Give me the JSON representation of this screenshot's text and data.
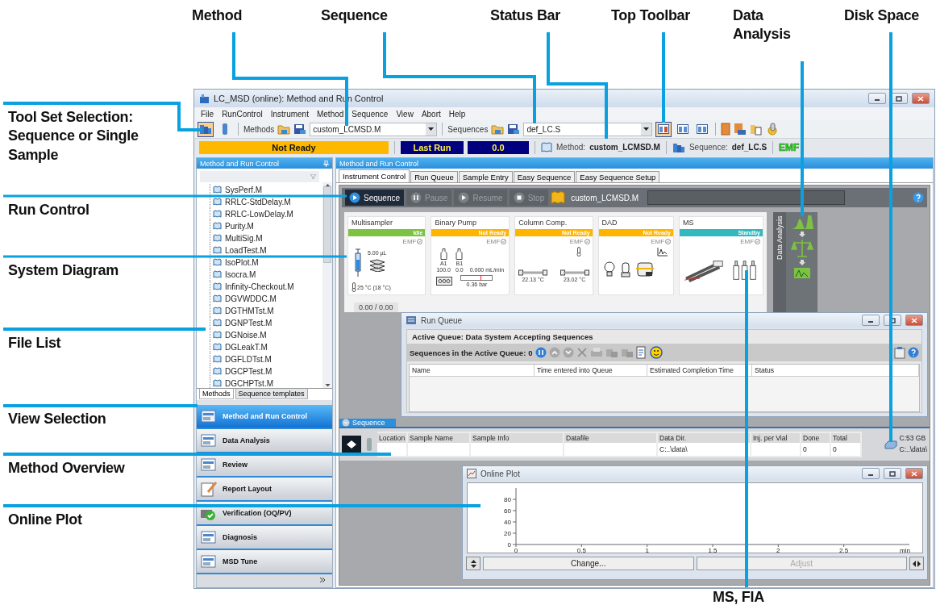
{
  "callouts": [
    "Method",
    "Sequence",
    "Status Bar",
    "Top Toolbar",
    "Data Analysis",
    "Disk Space",
    "Tool Set Selection: Sequence or Single Sample",
    "Run Control",
    "System Diagram",
    "File List",
    "View Selection",
    "Method Overview",
    "Online Plot",
    "MS, FIA"
  ],
  "window": {
    "title": "LC_MSD (online): Method and Run Control"
  },
  "menu": [
    "File",
    "RunControl",
    "Instrument",
    "Method",
    "Sequence",
    "View",
    "Abort",
    "Help"
  ],
  "toolbar": {
    "toolsets": [
      {
        "selected": true
      },
      {
        "selected": false
      }
    ],
    "methods_label": "Methods",
    "method": "custom_LCMSD.M",
    "sequences_label": "Sequences",
    "sequence": "def_LC.S",
    "views": [
      {
        "selected": true
      },
      {
        "selected": false
      },
      {
        "selected": false
      }
    ]
  },
  "status_bar": {
    "state": "Not Ready",
    "last_run": "Last Run",
    "last_run_value": "0.0",
    "method_label": "Method:",
    "method": "custom_LCMSD.M",
    "sequence_label": "Sequence:",
    "sequence": "def_LC.S",
    "emf": "EMF"
  },
  "left_panel": {
    "title": "Method and Run Control",
    "files": [
      "SysPerf.M",
      "RRLC-StdDelay.M",
      "RRLC-LowDelay.M",
      "Purity.M",
      "MultiSig.M",
      "LoadTest.M",
      "IsoPlot.M",
      "Isocra.M",
      "Infinity-Checkout.M",
      "DGVWDDC.M",
      "DGTHMTst.M",
      "DGNPTest.M",
      "DGNoise.M",
      "DGLeakT.M",
      "DGFLDTst.M",
      "DGCPTest.M",
      "DGCHPTst.M"
    ],
    "tabs": [
      {
        "label": "Methods",
        "selected": true
      },
      {
        "label": "Sequence templates",
        "selected": false
      }
    ],
    "views": [
      {
        "label": "Method and Run Control",
        "selected": true
      },
      {
        "label": "Data Analysis",
        "selected": false
      },
      {
        "label": "Review",
        "selected": false
      },
      {
        "label": "Report Layout",
        "selected": false
      },
      {
        "label": "Verification (OQ/PV)",
        "selected": false
      },
      {
        "label": "Diagnosis",
        "selected": false
      },
      {
        "label": "MSD Tune",
        "selected": false
      }
    ]
  },
  "main_panel": {
    "title": "Method and Run Control",
    "tabs": [
      {
        "label": "Instrument Control",
        "selected": true
      },
      {
        "label": "Run Queue",
        "selected": false
      },
      {
        "label": "Sample Entry",
        "selected": false
      },
      {
        "label": "Easy Sequence",
        "selected": false
      },
      {
        "label": "Easy Sequence Setup",
        "selected": false
      }
    ],
    "run_controls": [
      {
        "label": "Sequence",
        "disabled": false
      },
      {
        "label": "Pause",
        "disabled": true
      },
      {
        "label": "Resume",
        "disabled": true
      },
      {
        "label": "Stop",
        "disabled": true
      }
    ],
    "method": "custom_LCMSD.M",
    "modules": [
      {
        "kind": "sampler",
        "name": "Multisampler",
        "status": "Idle",
        "color": "#7dc242",
        "badge": "EMF",
        "readings": [
          "5.00 µL",
          "25 °C (18 °C)"
        ]
      },
      {
        "kind": "pump",
        "name": "Binary Pump",
        "status": "Not Ready",
        "color": "#ffb400",
        "badge": "EMF",
        "readings": [
          "A1",
          "B1",
          "100.0",
          "0.0",
          "0.000 mL/min",
          "0.36 bar"
        ],
        "level": 0.62
      },
      {
        "kind": "column",
        "name": "Column Comp.",
        "status": "Not Ready",
        "color": "#ffb400",
        "badge": "EMF",
        "readings": [
          "22.13 °C",
          "23.02 °C"
        ]
      },
      {
        "kind": "dad",
        "name": "DAD",
        "status": "Not Ready",
        "color": "#ffb400",
        "badge": "EMF"
      },
      {
        "kind": "ms",
        "name": "MS",
        "status": "Standby",
        "color": "#33b8bd",
        "badge": "EMF"
      }
    ],
    "progress": "0.00 / 0.00",
    "side_strip": "Data Analysis"
  },
  "run_queue": {
    "title": "Run Queue",
    "active": "Active Queue: Data System Accepting Sequences",
    "count_label": "Sequences in the Active Queue:",
    "count": "0",
    "columns": [
      "Name",
      "Time entered into Queue",
      "Estimated Completion Time",
      "Status"
    ]
  },
  "sequence_pane": {
    "title": "Sequence",
    "columns": [
      {
        "label": "Location"
      },
      {
        "label": "Sample Name"
      },
      {
        "label": "Sample Info"
      },
      {
        "label": "Datafile"
      },
      {
        "label": "Data Dir.",
        "value": "C:..\\data\\"
      },
      {
        "label": "Inj. per Vial"
      },
      {
        "label": "Done",
        "value": "0"
      },
      {
        "label": "Total",
        "value": "0"
      }
    ],
    "disk_space": "C:53 GB",
    "disk_path": "C:..\\data\\"
  },
  "online_plot": {
    "title": "Online Plot",
    "chart_data": {
      "type": "line",
      "xlabel": "min",
      "xlim": [
        0,
        3
      ],
      "ylim": [
        0,
        100
      ],
      "xticks": [
        0,
        0.5,
        1,
        1.5,
        2,
        2.5
      ],
      "yticks": [
        0,
        20,
        40,
        60,
        80
      ]
    },
    "buttons": [
      {
        "label": "Change...",
        "disabled": false
      },
      {
        "label": "Adjust",
        "disabled": true
      }
    ]
  }
}
